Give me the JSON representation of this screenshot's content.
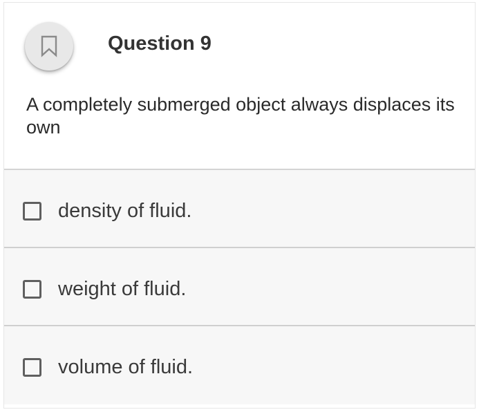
{
  "question": {
    "title": "Question 9",
    "text": "A completely submerged object always displaces its own",
    "bookmark_icon": "bookmark-icon"
  },
  "options": [
    {
      "label": "density of fluid.",
      "checked": false,
      "icon": "checkbox-unchecked-icon"
    },
    {
      "label": "weight of fluid.",
      "checked": false,
      "icon": "checkbox-unchecked-icon"
    },
    {
      "label": "volume of fluid.",
      "checked": false,
      "icon": "checkbox-unchecked-icon"
    }
  ],
  "colors": {
    "title_text": "#333333",
    "body_text": "#2a2a2a",
    "option_bg": "#f7f7f7",
    "divider": "#cfcfcf",
    "checkbox_border": "#5f5f5f",
    "bookmark_bg": "#e8e8e8"
  }
}
